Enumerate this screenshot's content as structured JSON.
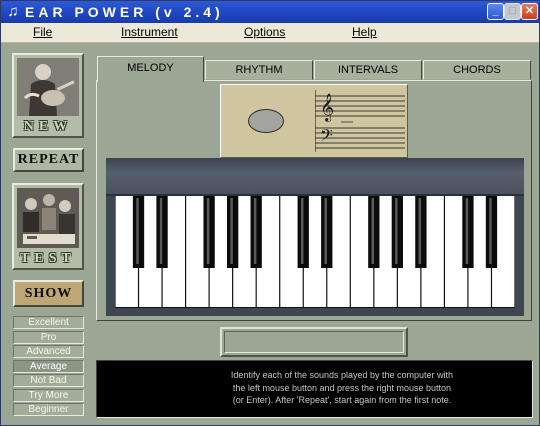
{
  "window": {
    "title": "EAR POWER (v 2.4)",
    "buttons": {
      "minimize": "_",
      "maximize": "□",
      "close": "✕"
    }
  },
  "menu": {
    "items": [
      "File",
      "Instrument",
      "Options",
      "Help"
    ]
  },
  "sidebar": {
    "new_label": "NEW",
    "repeat_label": "REPEAT",
    "test_label": "TEST",
    "show_label": "SHOW",
    "levels": [
      "Excellent",
      "Pro",
      "Advanced",
      "Average",
      "Not Bad",
      "Try More",
      "Beginner"
    ],
    "active_level": "Average"
  },
  "tabs": [
    "MELODY",
    "RHYTHM",
    "INTERVALS",
    "CHORDS"
  ],
  "active_tab": "MELODY",
  "answer_field": {
    "value": ""
  },
  "message": "Identify each of the sounds played by the computer with\nthe left mouse button and press the right mouse button\n(or Enter). After 'Repeat', start again from the first note.",
  "keyboard": {
    "white_keys": 17
  },
  "colors": {
    "window_bg": "#9ba694",
    "note_panel": "#cfc6a0",
    "show_button": "#bda774",
    "keyboard_frame": "#3d4651"
  }
}
